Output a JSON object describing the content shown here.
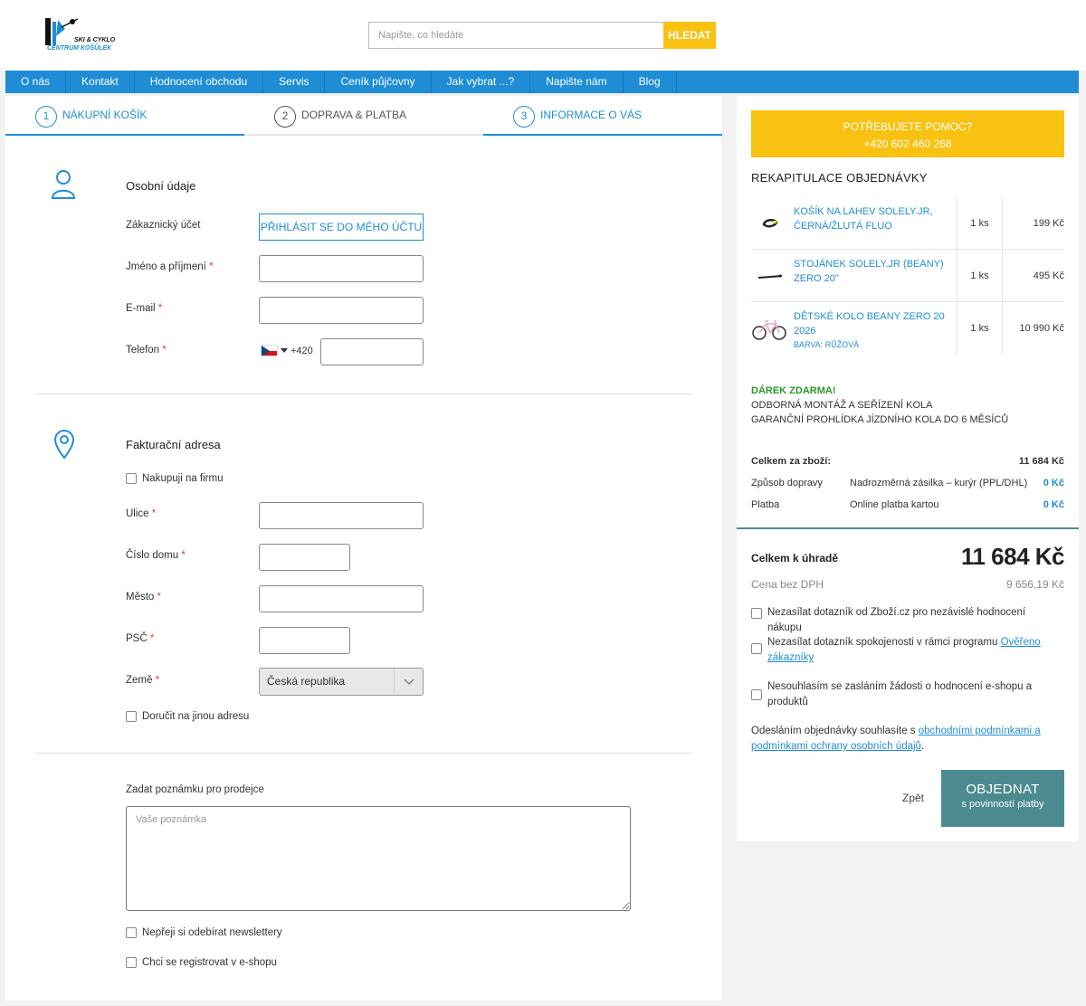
{
  "header": {
    "logo": {
      "top_text": "SKI & CYKLO",
      "bottom_text": "CENTRUM KOŠŮLEK"
    },
    "search": {
      "placeholder": "Napište, co hledáte",
      "button_label": "HLEDAT"
    }
  },
  "nav": {
    "items": [
      "O nás",
      "Kontakt",
      "Hodnocení obchodu",
      "Servis",
      "Ceník půjčovny",
      "Jak vybrat ...?",
      "Napište nám",
      "Blog"
    ]
  },
  "steps": [
    {
      "number": "1",
      "label": "NÁKUPNÍ KOŠÍK",
      "active": true
    },
    {
      "number": "2",
      "label": "DOPRAVA & PLATBA",
      "active": false
    },
    {
      "number": "3",
      "label": "INFORMACE O VÁS",
      "active": true
    }
  ],
  "personal": {
    "title": "Osobní údaje",
    "account_label": "Zákaznický účet",
    "login_button": "PŘIHLÁSIT SE DO MÉHO ÚČTU",
    "name_label": "Jméno a příjmení",
    "email_label": "E-mail",
    "phone_label": "Telefon",
    "phone_prefix": "+420",
    "required_mark": "*"
  },
  "billing": {
    "title": "Fakturační adresa",
    "company_checkbox": "Nakupuji na firmu",
    "street_label": "Ulice",
    "house_label": "Číslo domu",
    "city_label": "Město",
    "zip_label": "PSČ",
    "country_label": "Země",
    "country_value": "Česká republika",
    "other_address_checkbox": "Doručit na jinou adresu"
  },
  "note": {
    "label": "Zadat poznámku pro prodejce",
    "placeholder": "Vaše poznámka"
  },
  "options": {
    "newsletter": "Nepřeji si odebírat newslettery",
    "register": "Chci se registrovat v e-shopu"
  },
  "help": {
    "line1": "POTŘEBUJETE POMOC?",
    "line2": "+420 602 460 268"
  },
  "summary": {
    "title": "REKAPITULACE OBJEDNÁVKY",
    "items": [
      {
        "name": "KOŠÍK NA LAHEV SOLELY.JR, ČERNÁ/ŽLUTÁ FLUO",
        "variant": "",
        "qty": "1 ks",
        "price": "199 Kč"
      },
      {
        "name": "STOJÁNEK SOLELY.JR (BEANY) ZERO 20\"",
        "variant": "",
        "qty": "1 ks",
        "price": "495 Kč"
      },
      {
        "name": "DĚTSKÉ KOLO BEANY ZERO 20 2026",
        "variant": "BARVA: RŮŽOVÁ",
        "qty": "1 ks",
        "price": "10 990 Kč"
      }
    ],
    "gift_title": "DÁREK ZDARMA!",
    "gift_line1": "ODBORNÁ MONTÁŽ A SEŘÍZENÍ KOLA",
    "gift_line2": "GARANČNÍ PROHLÍDKA JÍZDNÍHO KOLA DO 6 MĚSÍCŮ",
    "goods_label": "Celkem za zboží:",
    "goods_value": "11 684 Kč",
    "shipping_label": "Způsob dopravy",
    "shipping_method": "Nadrozměrná zásilka – kurýr (PPL/DHL)",
    "shipping_value": "0 Kč",
    "payment_label": "Platba",
    "payment_method": "Online platba kartou",
    "payment_value": "0 Kč",
    "total_label": "Celkem k úhradě",
    "total_value": "11 684 Kč",
    "vat_label": "Cena bez DPH",
    "vat_value": "9 656,19 Kč",
    "consent1": "Nezasílat dotazník od Zboží.cz pro nezávislé hodnocení nákupu",
    "consent2_text": "Nezasílat dotazník spokojenosti v rámci programu ",
    "consent2_link": "Ověřeno zákazníky",
    "consent3": "Nesouhlasím se zasláním žádosti o hodnocení e-shopu a produktů",
    "terms_text": "Odesláním objednávky souhlasíte s ",
    "terms_link": "obchodními podmínkami a podmínkami ochrany osobních údajů",
    "terms_end": ".",
    "back_label": "Zpět",
    "order_label": "OBJEDNAT",
    "order_sub": "s povinností platby"
  },
  "colors": {
    "accent": "#1f8dd6",
    "yellow": "#f9c212",
    "teal": "#4b8b8f",
    "gift_green": "#2a9a27",
    "required": "#e23d3d"
  }
}
